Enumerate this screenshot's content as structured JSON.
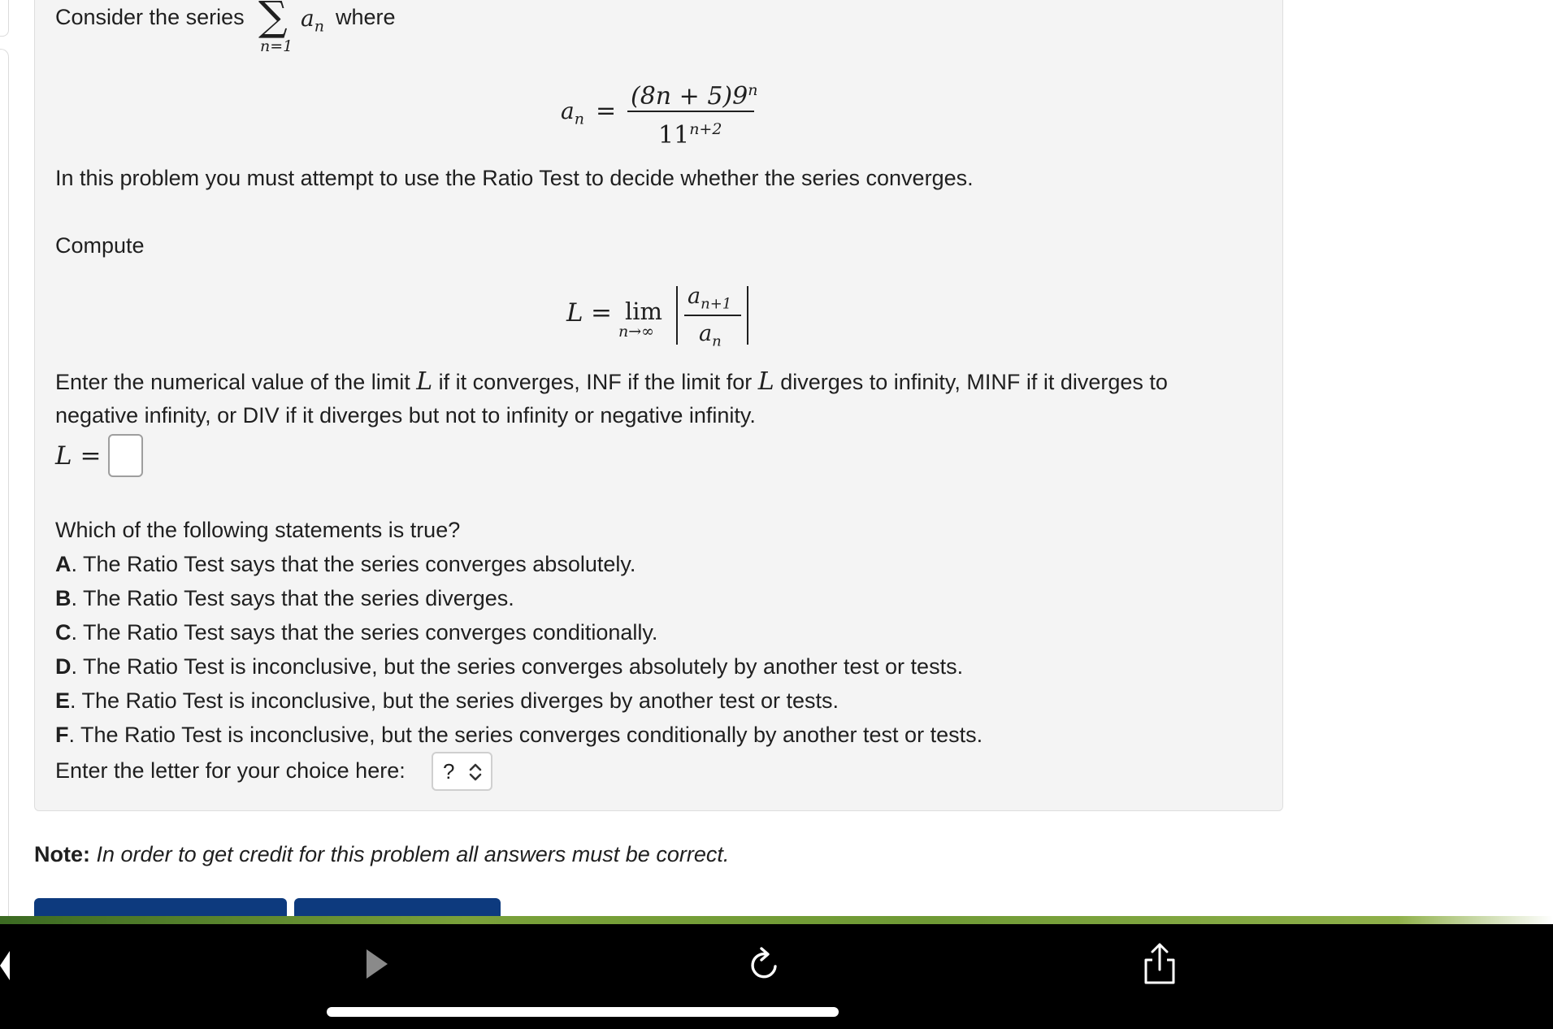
{
  "problem": {
    "intro_before": "Consider the series",
    "sum_symbol": "∑",
    "sum_lower": "n=1",
    "sum_term": "a",
    "sum_term_sub": "n",
    "intro_after": "where",
    "formula_lhs": "a",
    "formula_lhs_sub": "n",
    "equals": "=",
    "numerator": "(8n + 5)9",
    "numerator_exp": "n",
    "denominator": "11",
    "denominator_exp": "n+2",
    "ratio_instruction": "In this problem you must attempt to use the Ratio Test to decide whether the series converges.",
    "compute_label": "Compute",
    "limit_lhs": "L",
    "limit_word": "lim",
    "limit_under": "n→∞",
    "ratio_num": "a",
    "ratio_num_sub": "n+1",
    "ratio_den": "a",
    "ratio_den_sub": "n",
    "enter_line1_a": "Enter the numerical value of the limit",
    "enter_L": "L",
    "enter_line1_b": "if it converges, INF if the limit for",
    "enter_line1_c": "diverges to infinity, MINF if it diverges to",
    "enter_line2": "negative infinity, or DIV if it diverges but not to infinity or negative infinity.",
    "answer_label": "L =",
    "question": "Which of the following statements is true?",
    "choices": [
      {
        "letter": "A",
        "text": ". The Ratio Test says that the series converges absolutely."
      },
      {
        "letter": "B",
        "text": ". The Ratio Test says that the series diverges."
      },
      {
        "letter": "C",
        "text": ". The Ratio Test says that the series converges conditionally."
      },
      {
        "letter": "D",
        "text": ". The Ratio Test is inconclusive, but the series converges absolutely by another test or tests."
      },
      {
        "letter": "E",
        "text": ". The Ratio Test is inconclusive, but the series diverges by another test or tests."
      },
      {
        "letter": "F",
        "text": ". The Ratio Test is inconclusive, but the series converges conditionally by another test or tests."
      }
    ],
    "select_label": "Enter the letter for your choice here:",
    "select_value": "?"
  },
  "note": {
    "label": "Note:",
    "text": "In order to get credit for this problem all answers must be correct."
  },
  "toolbar": {
    "icons": [
      "back-arrow-icon",
      "forward-arrow-icon",
      "reload-icon",
      "share-icon"
    ]
  },
  "colors": {
    "panel_bg": "#f4f4f4",
    "button_blue": "#0d3a7e",
    "toolbar_bg": "#000000"
  }
}
